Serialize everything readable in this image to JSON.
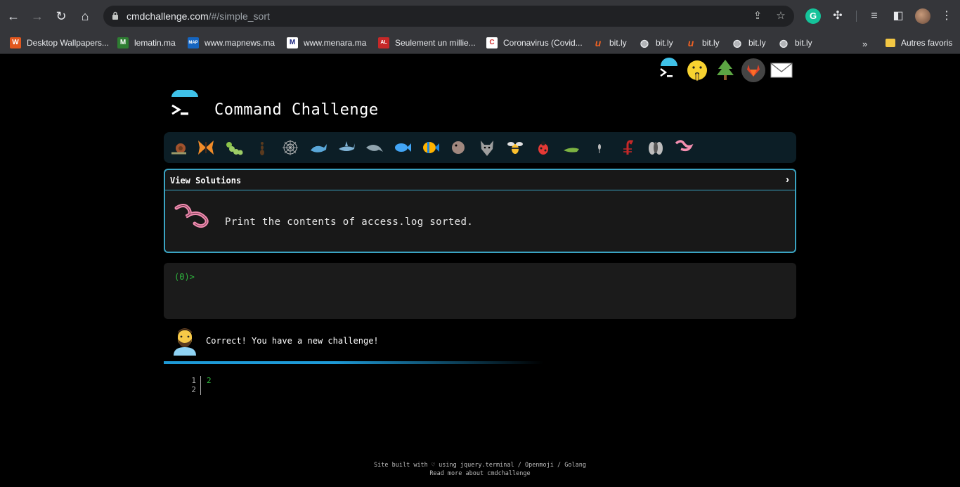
{
  "browser": {
    "url_host": "cmdchallenge.com",
    "url_path": "/#/simple_sort",
    "bookmarks": [
      {
        "label": "Desktop Wallpapers...",
        "color": "#e2571e",
        "glyph": "W"
      },
      {
        "label": "lematin.ma",
        "color": "#2e7d32",
        "glyph": "M"
      },
      {
        "label": "www.mapnews.ma",
        "color": "#1565c0",
        "glyph": "MAP"
      },
      {
        "label": "www.menara.ma",
        "color": "#1a237e",
        "glyph": "M"
      },
      {
        "label": "Seulement un millie...",
        "color": "#c62828",
        "glyph": "AL"
      },
      {
        "label": "Coronavirus (Covid...",
        "color": "#d32f2f",
        "glyph": "C"
      },
      {
        "label": "bit.ly",
        "color": "#ee6123",
        "glyph": "u"
      },
      {
        "label": "bit.ly",
        "color": "#5f6368",
        "glyph": "◍"
      },
      {
        "label": "bit.ly",
        "color": "#ee6123",
        "glyph": "u"
      },
      {
        "label": "bit.ly",
        "color": "#5f6368",
        "glyph": "◍"
      },
      {
        "label": "bit.ly",
        "color": "#5f6368",
        "glyph": "◍"
      }
    ],
    "more_bookmarks": "»",
    "other_bookmarks": "Autres favoris"
  },
  "site": {
    "title": "Command Challenge",
    "challenge_header": "View Solutions",
    "challenge_text": "Print the contents of access.log sorted.",
    "prompt": "(0)>",
    "feedback": "Correct! You have a new challenge!",
    "output_lines": [
      "1",
      "2"
    ],
    "output_text": "2",
    "footer_line1": "Site built with ♡ using jquery.terminal / Openmoji / Golang",
    "footer_line2": "Read more about cmdchallenge"
  },
  "colors": {
    "accent": "#3aa3c2",
    "terminal_green": "#2fb93e",
    "progress": "#1e9ad6"
  },
  "level_icons": [
    "snail-icon",
    "butterfly-icon",
    "caterpillar-icon",
    "ant-icon",
    "spider-web-icon",
    "whale-icon",
    "shark-icon",
    "dolphin-icon",
    "fish-icon",
    "tropical-fish-icon",
    "blowfish-icon",
    "wolf-icon",
    "bee-icon",
    "ladybug-icon",
    "cricket-icon",
    "mosquito-icon",
    "scorpion-icon",
    "fly-icon",
    "worm-icon"
  ]
}
